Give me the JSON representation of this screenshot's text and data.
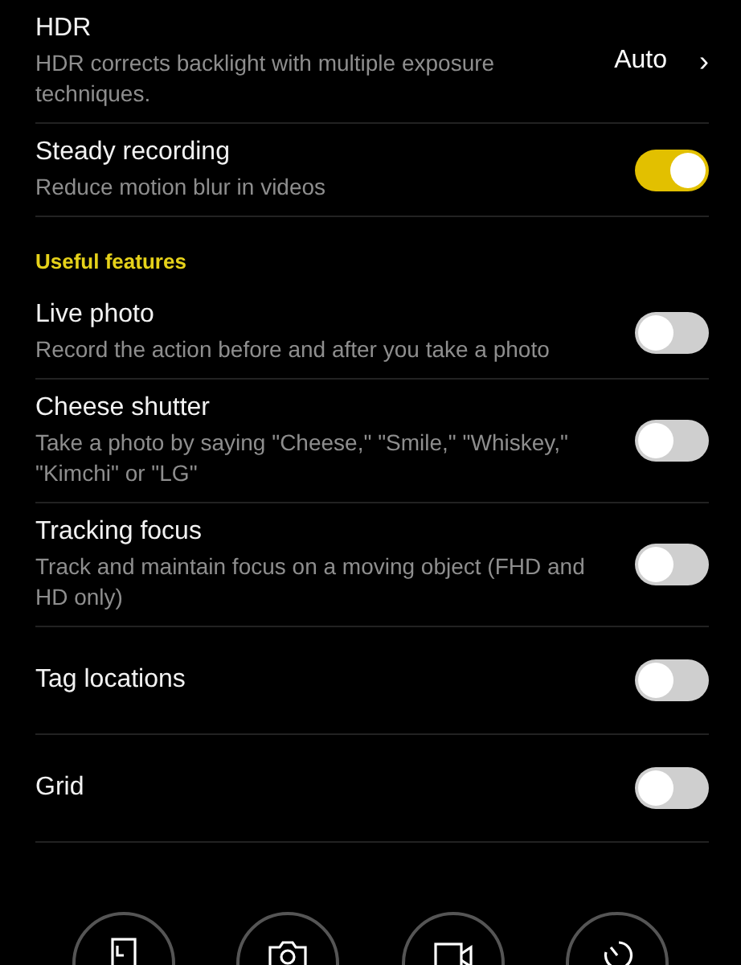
{
  "settings": [
    {
      "kind": "value",
      "title": "HDR",
      "subtitle": "HDR corrects backlight with multiple exposure techniques.",
      "value": "Auto",
      "chevron": "›"
    },
    {
      "kind": "toggle",
      "title": "Steady recording",
      "subtitle": "Reduce motion blur in videos",
      "on": true
    }
  ],
  "section": {
    "title": "Useful features",
    "items": [
      {
        "kind": "toggle",
        "title": "Live photo",
        "subtitle": "Record the action before and after you take a photo",
        "on": false
      },
      {
        "kind": "toggle",
        "title": "Cheese shutter",
        "subtitle": "Take a photo by saying \"Cheese,\" \"Smile,\" \"Whiskey,\" \"Kimchi\" or \"LG\"",
        "on": false
      },
      {
        "kind": "toggle",
        "title": "Tracking focus",
        "subtitle": "Track and maintain focus on a moving object (FHD and HD only)",
        "on": false
      },
      {
        "kind": "toggle",
        "title": "Tag locations",
        "on": false
      },
      {
        "kind": "toggle",
        "title": "Grid",
        "on": false
      }
    ]
  },
  "mode_buttons": [
    {
      "kind": "portrait"
    },
    {
      "kind": "camera"
    },
    {
      "kind": "video"
    },
    {
      "kind": "timer"
    }
  ]
}
